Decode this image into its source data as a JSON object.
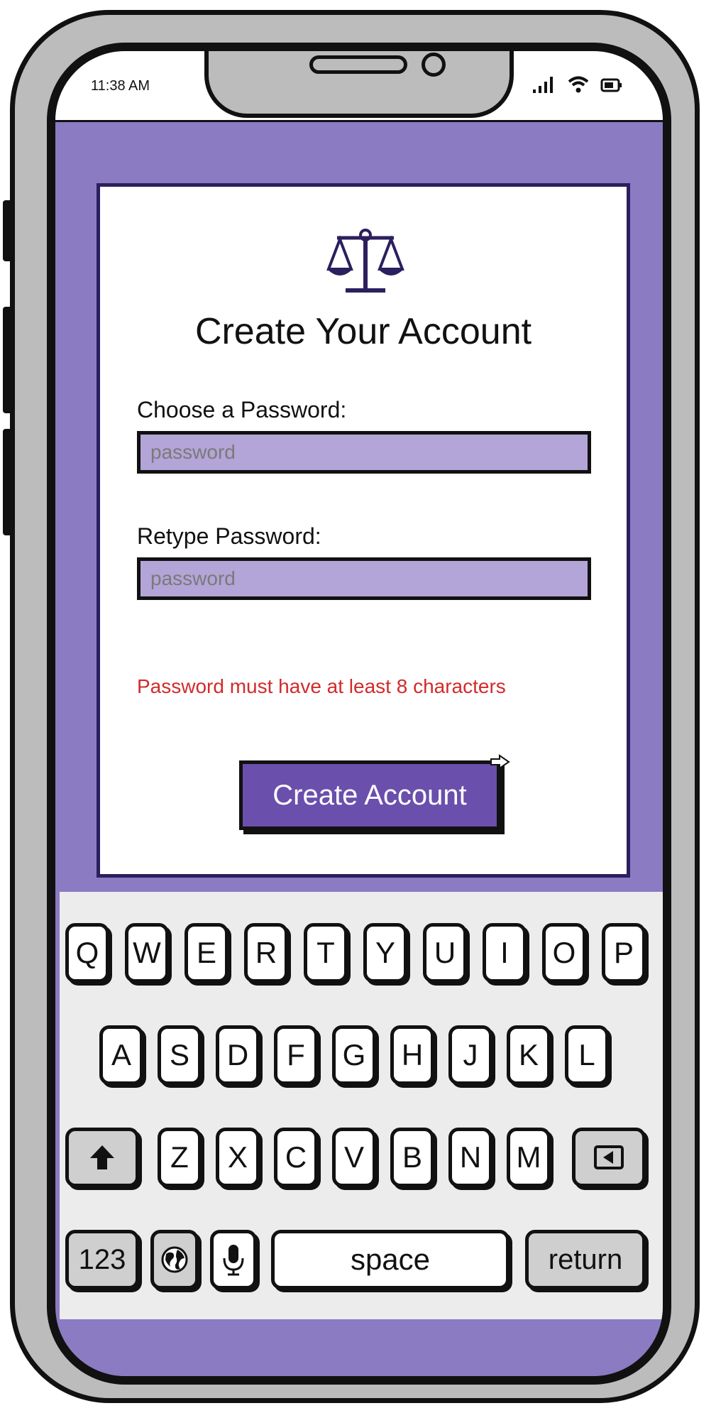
{
  "status_bar": {
    "time": "11:38 AM",
    "icons": [
      "signal-icon",
      "wifi-icon",
      "battery-icon"
    ]
  },
  "card": {
    "logo_icon": "scales-icon",
    "title": "Create Your Account",
    "password_label": "Choose a Password:",
    "password_placeholder": "password",
    "retype_label": "Retype Password:",
    "retype_placeholder": "password",
    "error": "Password must have at least 8 characters",
    "submit_label": "Create Account"
  },
  "keyboard": {
    "row1": [
      "Q",
      "W",
      "E",
      "R",
      "T",
      "Y",
      "U",
      "I",
      "O",
      "P"
    ],
    "row2": [
      "A",
      "S",
      "D",
      "F",
      "G",
      "H",
      "J",
      "K",
      "L"
    ],
    "row3": [
      "Z",
      "X",
      "C",
      "V",
      "B",
      "N",
      "M"
    ],
    "shift_icon": "shift-arrow-icon",
    "backspace_icon": "backspace-icon",
    "numbers_label": "123",
    "globe_icon": "globe-icon",
    "mic_icon": "microphone-icon",
    "space_label": "space",
    "return_label": "return"
  },
  "colors": {
    "accent": "#6a4fac",
    "screen_bg": "#8b7bc2",
    "field_bg": "#b3a5d7",
    "error": "#d12b2b"
  }
}
